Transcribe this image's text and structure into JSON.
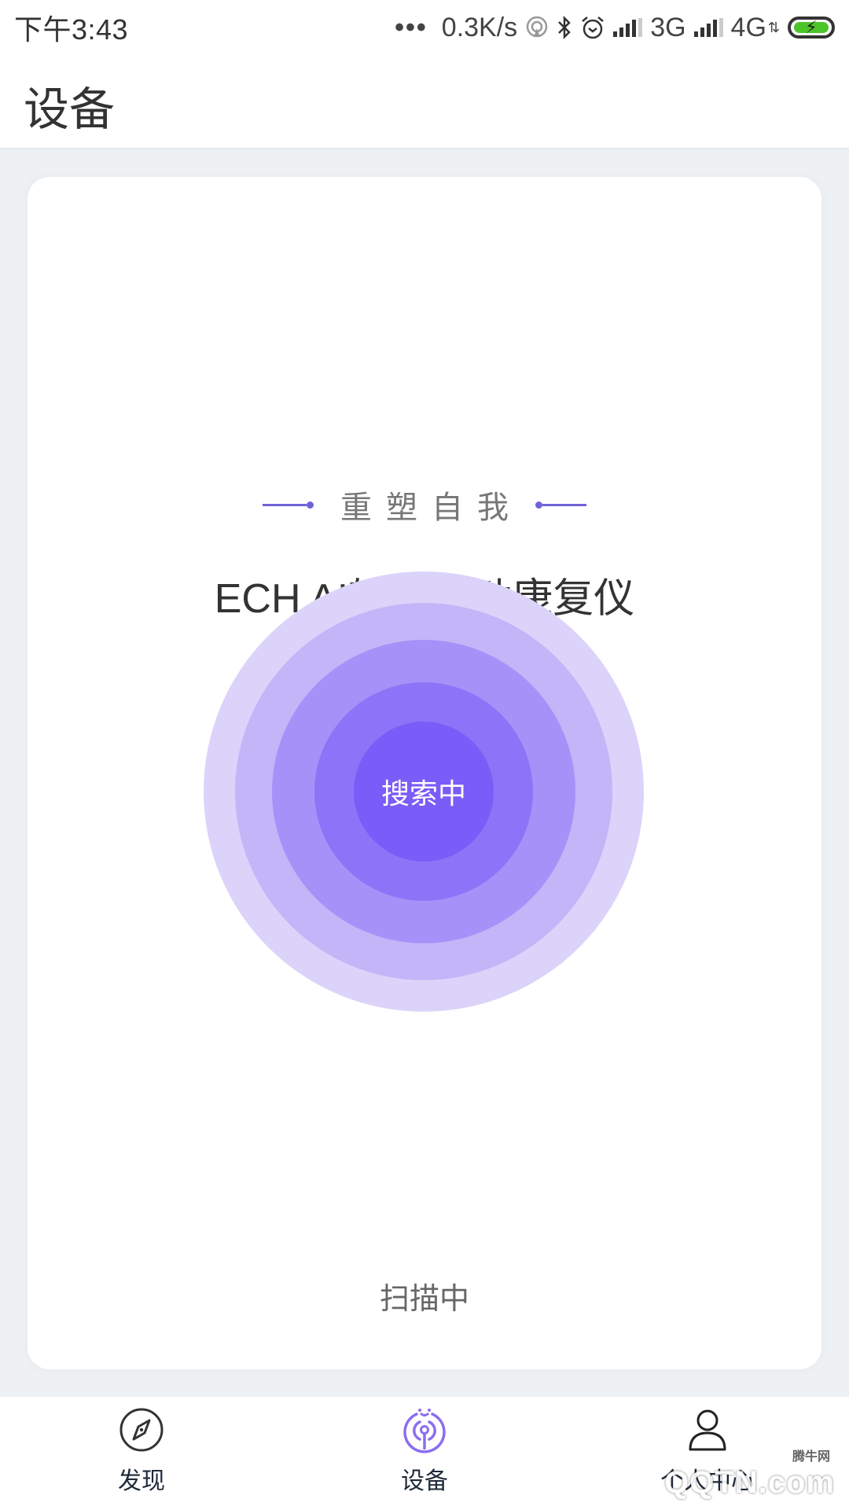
{
  "status_bar": {
    "time": "下午3:43",
    "more_icon": "more-dots-icon",
    "net_speed": "0.3K/s",
    "icons": [
      "hotspot-icon",
      "bluetooth-icon",
      "alarm-icon",
      "signal-icon",
      "signal-icon",
      "battery-charging-icon"
    ],
    "network_1": "3G",
    "network_2": "4G",
    "battery_color": "#4cc42a"
  },
  "header": {
    "title": "设备"
  },
  "card": {
    "slogan": "重塑自我",
    "product_title": "ECH AI辅助运动康复仪",
    "radar": {
      "center_label": "搜索中",
      "ring_colors": [
        "#dcd3fa",
        "#c3b5f8",
        "#a592f8",
        "#8c74f8",
        "#7a5cf8"
      ]
    },
    "scan_status": "扫描中"
  },
  "accent_color": "#6f63d8",
  "tab_bar": {
    "active_index": 1,
    "active_color": "#8a6ef0",
    "items": [
      {
        "label": "发现",
        "icon": "compass-icon"
      },
      {
        "label": "设备",
        "icon": "device-signal-icon"
      },
      {
        "label": "个人中心",
        "icon": "user-icon"
      }
    ]
  },
  "watermark": {
    "top": "腾牛网",
    "main": "QQTN.com"
  }
}
